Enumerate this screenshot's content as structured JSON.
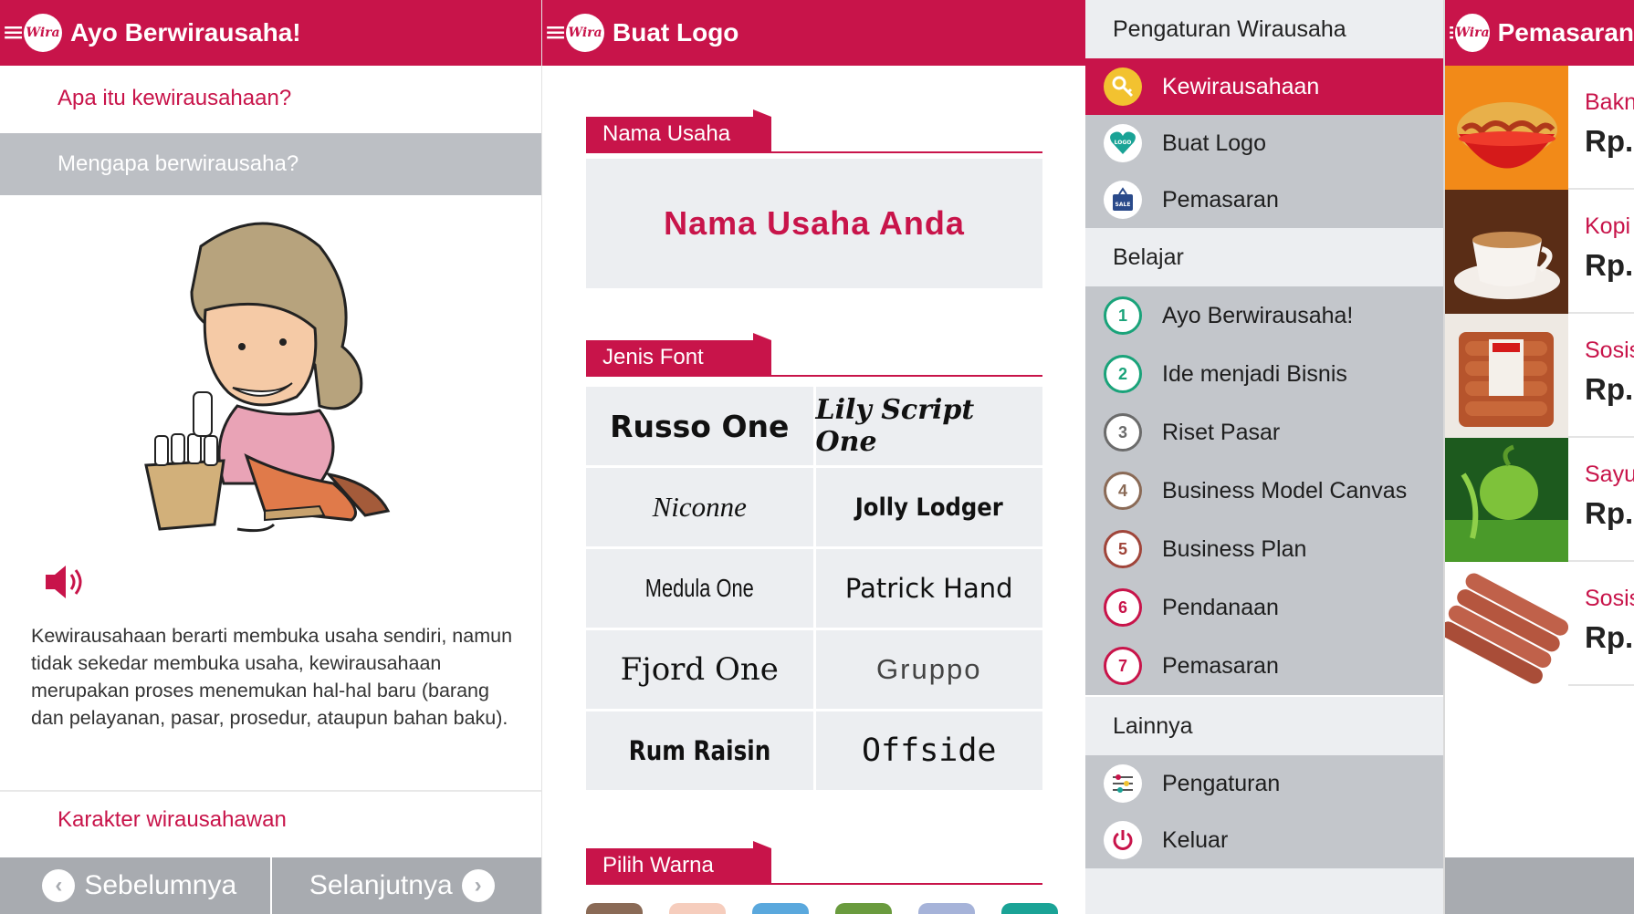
{
  "colors": {
    "primary": "#c8144a",
    "gray": "#bcbfc4",
    "light": "#eceef1"
  },
  "app_logo_text": "Wira",
  "panel1": {
    "title": "Ayo Berwirausaha!",
    "q1": "Apa itu kewirausahaan?",
    "q2": "Mengapa berwirausaha?",
    "body": "Kewirausahaan berarti membuka usaha sendiri, namun tidak sekedar membuka usaha, kewirausahaan merupakan proses menemukan hal-hal baru (barang dan pelayanan, pasar, prosedur, ataupun bahan baku).",
    "q3": "Karakter wirausahawan",
    "prev": "Sebelumnya",
    "next": "Selanjutnya"
  },
  "panel2": {
    "title": "Buat Logo",
    "section_name": "Nama Usaha",
    "name_value": "Nama Usaha Anda",
    "section_font": "Jenis Font",
    "fonts": [
      "Russo One",
      "Lily Script One",
      "Niconne",
      "Jolly Lodger",
      "Medula One",
      "Patrick Hand",
      "Fjord One",
      "Gruppo",
      "Rum Raisin",
      "Offside"
    ],
    "section_color": "Pilih Warna",
    "swatches": [
      "#8a6a56",
      "#f6cdbd",
      "#5aa8dd",
      "#6a9b3e",
      "#a6b3d9",
      "#1aa396"
    ]
  },
  "panel3": {
    "header": "Pengaturan Wirausaha",
    "group1": [
      {
        "label": "Kewirausahaan",
        "icon": "key-icon",
        "active": true
      },
      {
        "label": "Buat Logo",
        "icon": "logo-heart-icon",
        "active": false
      },
      {
        "label": "Pemasaran",
        "icon": "sale-bag-icon",
        "active": false
      }
    ],
    "header_learn": "Belajar",
    "learn": [
      {
        "n": "1",
        "label": "Ayo Berwirausaha!",
        "color": "#1aa37a"
      },
      {
        "n": "2",
        "label": "Ide menjadi Bisnis",
        "color": "#1aa37a"
      },
      {
        "n": "3",
        "label": "Riset Pasar",
        "color": "#6b6b6b"
      },
      {
        "n": "4",
        "label": "Business Model Canvas",
        "color": "#8a6a56"
      },
      {
        "n": "5",
        "label": "Business Plan",
        "color": "#a0453a"
      },
      {
        "n": "6",
        "label": "Pendanaan",
        "color": "#c8144a"
      },
      {
        "n": "7",
        "label": "Pemasaran",
        "color": "#c8144a"
      }
    ],
    "header_other": "Lainnya",
    "other": [
      {
        "label": "Pengaturan",
        "icon": "settings-icon"
      },
      {
        "label": "Keluar",
        "icon": "power-icon"
      }
    ]
  },
  "panel4": {
    "title": "Pemasaran",
    "items": [
      {
        "name": "Bakn",
        "price": "Rp."
      },
      {
        "name": "Kopi",
        "price": "Rp."
      },
      {
        "name": "Sosis",
        "price": "Rp."
      },
      {
        "name": "Sayu",
        "price": "Rp."
      },
      {
        "name": "Sosis",
        "price": "Rp."
      }
    ]
  }
}
